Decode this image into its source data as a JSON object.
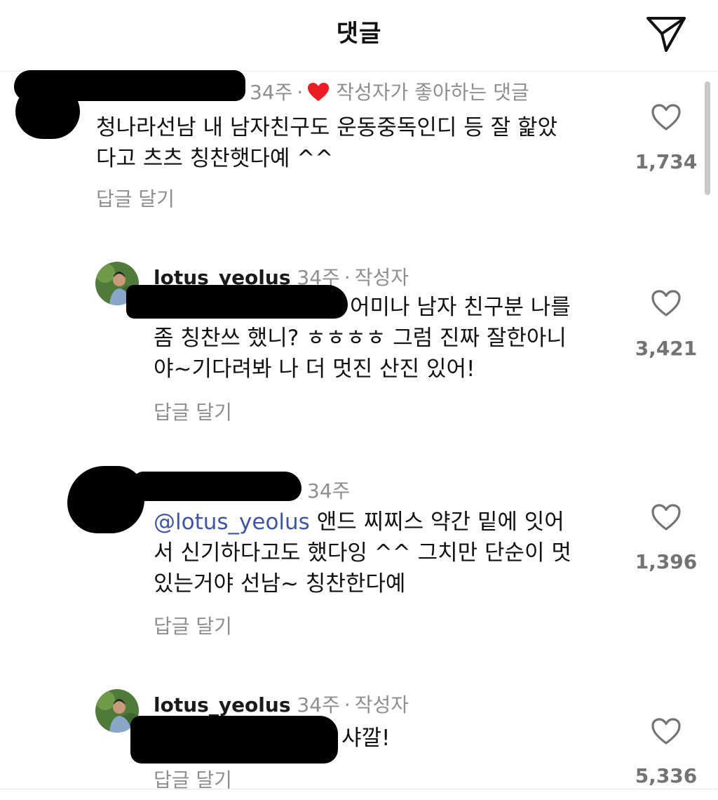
{
  "header": {
    "title": "댓글",
    "send_icon": "paper-plane-icon"
  },
  "comments": [
    {
      "username": "",
      "time": "34주",
      "creator_like_label": "작성자가 좋아하는 댓글",
      "creator_like_icon": "heart-filled-icon",
      "text_lines": [
        "청나라선남 내 남자친구도 운동중독인디 등 잘 핥았",
        "다고 츠츠 칭찬햇다예 ^^"
      ],
      "reply_label": "답글 달기",
      "likes": "1,734"
    },
    {
      "username": "lotus_yeolus",
      "time": "34주",
      "author_badge": "작성자",
      "mention": "",
      "text_lines": [
        "어미나 남자 친구분 나를",
        "좀 칭찬쓰 했니? ㅎㅎㅎㅎ 그럼 진짜 잘한아니",
        "야~기다려봐 나 더 멋진 산진 있어!"
      ],
      "reply_label": "답글 달기",
      "likes": "3,421"
    },
    {
      "username": "",
      "time": "34주",
      "mention": "@lotus_yeolus",
      "text_lines": [
        "앤드 찌찌스 약간 밑에 잇어",
        "서 신기하다고도 했다잉 ^^ 그치만 단순이 멋",
        "있는거야 선남~ 칭찬한다예"
      ],
      "reply_label": "답글 달기",
      "likes": "1,396"
    },
    {
      "username": "lotus_yeolus",
      "time": "34주",
      "author_badge": "작성자",
      "text_lines": [
        "샤깔!"
      ],
      "reply_label": "답글 달기",
      "likes": "5,336"
    }
  ],
  "colors": {
    "mention": "#3d55a8",
    "heart_red": "#ed1c24",
    "meta_gray": "#8e8e8e"
  }
}
